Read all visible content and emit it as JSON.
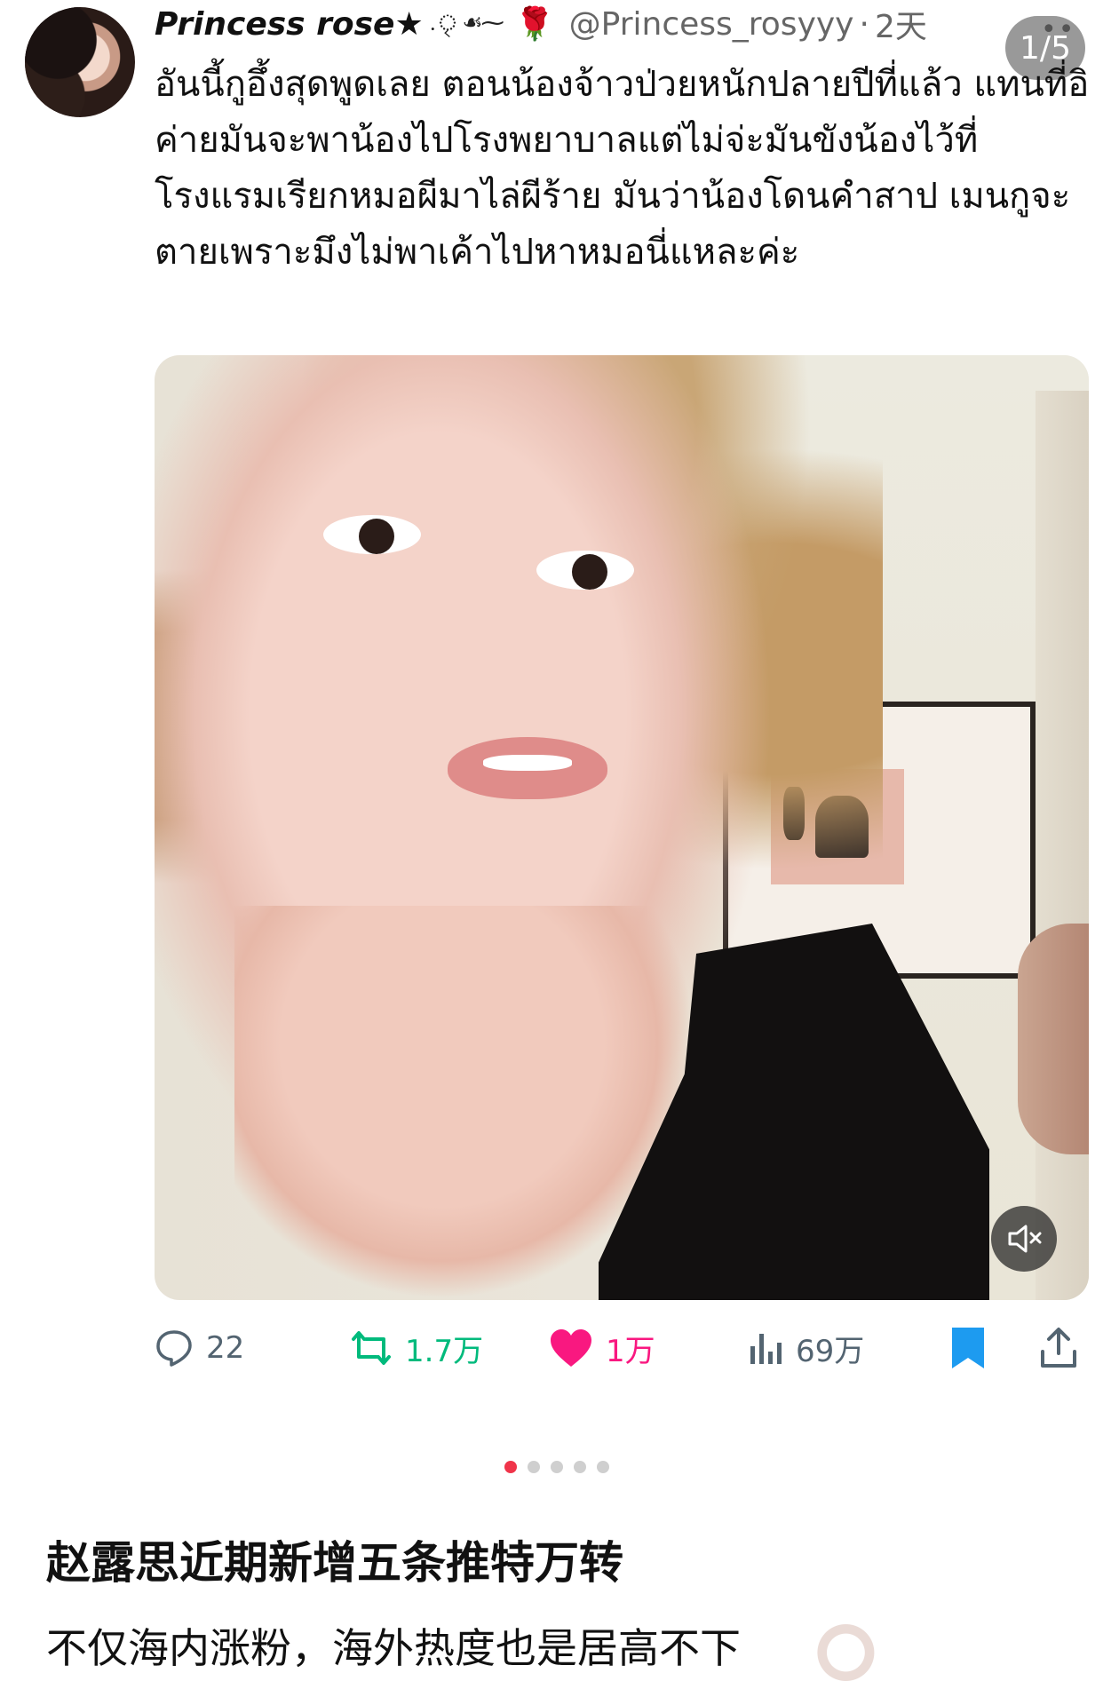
{
  "tweet": {
    "display_name": "Princess rose★",
    "name_decoration": ".ৃ ☙⁓",
    "rose_icon": "🌹",
    "handle": "@Princess_rosyyy",
    "separator": "·",
    "time": "2天",
    "image_counter": "1/5",
    "more_icon": "••",
    "text": "อันนี้กูอึ้งสุดพูดเลย ตอนน้องจ้าวป่วยหนักปลายปีที่แล้ว แทนที่อิค่ายมันจะพาน้องไปโรงพยาบาลแต่ไม่จ่ะมันขังน้องไว้ที่โรงแรมเรียกหมอผีมาไล่ผีร้าย มันว่าน้องโดนคำสาป เมนกูจะตายเพราะมึงไม่พาเค้าไปหาหมอนี่แหละค่ะ"
  },
  "actions": {
    "replies": "22",
    "retweets": "1.7万",
    "likes": "1万",
    "views": "69万"
  },
  "icons": {
    "reply": "reply-icon",
    "retweet": "retweet-icon",
    "like": "heart-icon",
    "views": "views-icon",
    "bookmark": "bookmark-icon",
    "share": "share-icon",
    "mute": "mute-icon"
  },
  "carousel": {
    "total": 5,
    "active": 1
  },
  "post": {
    "headline": "赵露思近期新增五条推特万转",
    "subline": "不仅海内涨粉，海外热度也是居高不下"
  },
  "colors": {
    "retweet": "#00ba7c",
    "like": "#f91880",
    "bookmark": "#1d9bf0",
    "muted": "#536471",
    "dot_active": "#f0344a"
  }
}
